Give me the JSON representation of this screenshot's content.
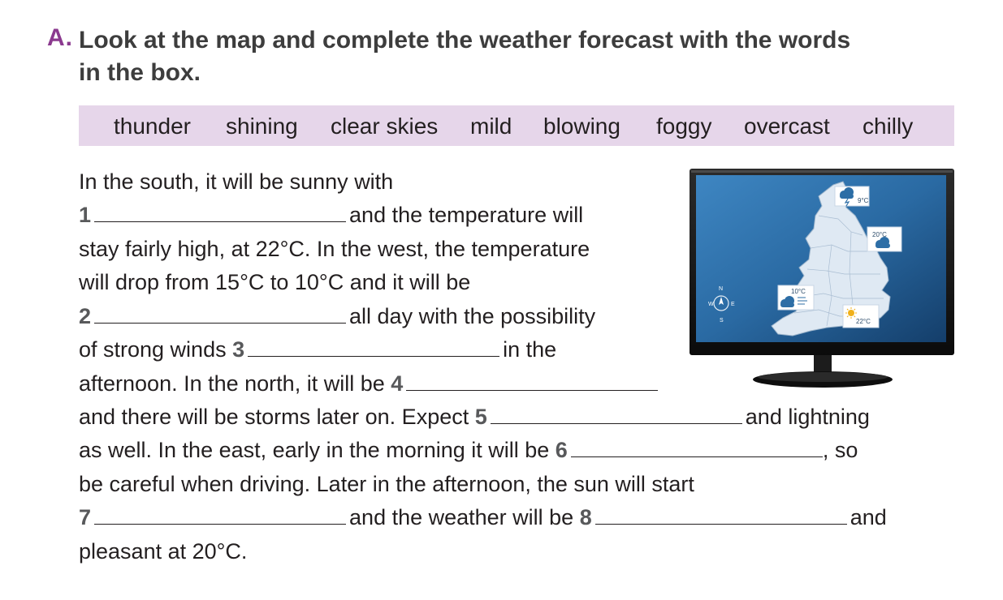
{
  "exercise": {
    "letter": "A.",
    "instruction_line1": "Look at the map and complete the weather forecast with the words",
    "instruction_line2": "in the box."
  },
  "word_box": [
    "thunder",
    "shining",
    "clear skies",
    "mild",
    "blowing",
    "foggy",
    "overcast",
    "chilly"
  ],
  "text": {
    "l1": "In the south, it will be sunny with",
    "n1": "1",
    "l2": "and the temperature will",
    "l3": "stay fairly high, at 22°C. In the west, the temperature",
    "l4": "will drop from 15°C to 10°C and it will be",
    "n2": "2",
    "l5": "all day with the possibility",
    "l6a": "of strong winds",
    "n3": "3",
    "l6b": "in the",
    "l7": "afternoon. In the north, it will be",
    "n4": "4",
    "l8a": "and there will be storms later on. Expect",
    "n5": "5",
    "l8b": "and lightning",
    "l9a": "as well. In the east, early in the morning it will be",
    "n6": "6",
    "l9b": ", so",
    "l10": "be careful when driving. Later in the afternoon, the sun will start",
    "n7": "7",
    "l11a": "and the weather will be",
    "n8": "8",
    "l11b": "and",
    "l12": "pleasant at 20°C."
  },
  "map": {
    "temp_north": "9°C",
    "temp_east": "20°C",
    "temp_west": "10°C",
    "temp_south": "22°C",
    "compass": {
      "n": "N",
      "s": "S",
      "e": "E",
      "w": "W"
    }
  },
  "colors": {
    "accent": "#8b3a8f",
    "box": "#e6d6ea",
    "screen": "#1f5f93"
  }
}
